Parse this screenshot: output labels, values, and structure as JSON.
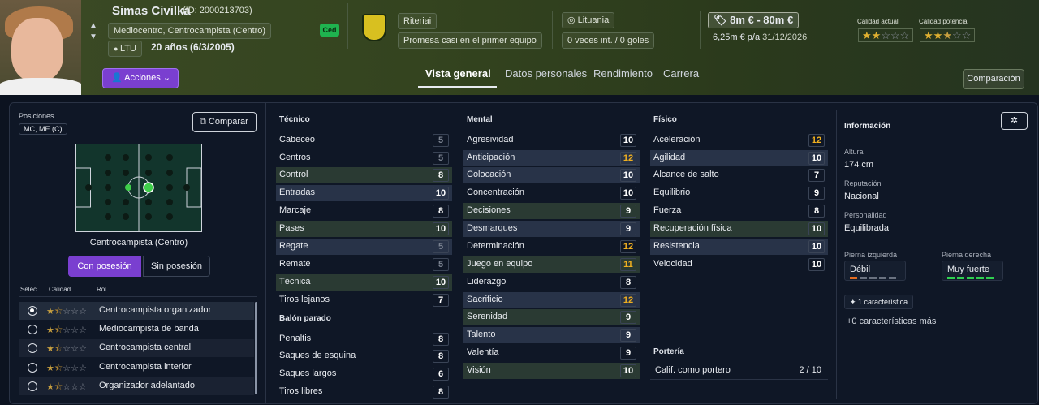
{
  "player": {
    "name": "Simas Civilka",
    "id_text": "(ID: 2000213703)",
    "position_text": "Mediocentro, Centrocampista (Centro)",
    "nation": "LTU",
    "age_text": "20 años (6/3/2005)",
    "badge": "Ced"
  },
  "club": {
    "name": "Riteriai",
    "status": "Promesa casi en el primer equipo"
  },
  "nationality": {
    "country": "Lituania",
    "caps": "0 veces int. / 0 goles"
  },
  "value": {
    "range": "8m € - 80m €",
    "wage": "6,25m € p/a",
    "contract_end": "31/12/2026"
  },
  "ratings": {
    "current_label": "Calidad actual",
    "potential_label": "Calidad potencial",
    "current_stars": 2,
    "potential_stars": 2.5
  },
  "actions_label": "Acciones",
  "tabs": [
    "Vista general",
    "Datos personales",
    "Rendimiento",
    "Carrera"
  ],
  "comparison_btn": "Comparación",
  "left": {
    "positions_label": "Posiciones",
    "positions_value": "MC, ME (C)",
    "compare_btn": "Comparar",
    "pitch_caption": "Centrocampista (Centro)",
    "with_ball": "Con posesión",
    "without_ball": "Sin posesión",
    "col_select": "Selec...",
    "col_quality": "Calidad",
    "col_role": "Rol",
    "roles": [
      {
        "name": "Centrocampista organizador",
        "stars": 1.5
      },
      {
        "name": "Mediocampista de banda",
        "stars": 1.5
      },
      {
        "name": "Centrocampista central",
        "stars": 1.5
      },
      {
        "name": "Centrocampista interior",
        "stars": 1.5
      },
      {
        "name": "Organizador adelantado",
        "stars": 1.5
      }
    ]
  },
  "attributes": {
    "tecnico_label": "Técnico",
    "tecnico": [
      [
        "Cabeceo",
        "5"
      ],
      [
        "Centros",
        "5"
      ],
      [
        "Control",
        "8"
      ],
      [
        "Entradas",
        "10"
      ],
      [
        "Marcaje",
        "8"
      ],
      [
        "Pases",
        "10"
      ],
      [
        "Regate",
        "5"
      ],
      [
        "Remate",
        "5"
      ],
      [
        "Técnica",
        "10"
      ],
      [
        "Tiros lejanos",
        "7"
      ]
    ],
    "balon_label": "Balón parado",
    "balon": [
      [
        "Penaltis",
        "8"
      ],
      [
        "Saques de esquina",
        "8"
      ],
      [
        "Saques largos",
        "6"
      ],
      [
        "Tiros libres",
        "8"
      ]
    ],
    "mental_label": "Mental",
    "mental": [
      [
        "Agresividad",
        "10"
      ],
      [
        "Anticipación",
        "12"
      ],
      [
        "Colocación",
        "10"
      ],
      [
        "Concentración",
        "10"
      ],
      [
        "Decisiones",
        "9"
      ],
      [
        "Desmarques",
        "9"
      ],
      [
        "Determinación",
        "12"
      ],
      [
        "Juego en equipo",
        "11"
      ],
      [
        "Liderazgo",
        "8"
      ],
      [
        "Sacrificio",
        "12"
      ],
      [
        "Serenidad",
        "9"
      ],
      [
        "Talento",
        "9"
      ],
      [
        "Valentía",
        "9"
      ],
      [
        "Visión",
        "10"
      ]
    ],
    "fisico_label": "Físico",
    "fisico": [
      [
        "Aceleración",
        "12"
      ],
      [
        "Agilidad",
        "10"
      ],
      [
        "Alcance de salto",
        "7"
      ],
      [
        "Equilibrio",
        "9"
      ],
      [
        "Fuerza",
        "8"
      ],
      [
        "Recuperación física",
        "10"
      ],
      [
        "Resistencia",
        "10"
      ],
      [
        "Velocidad",
        "10"
      ]
    ],
    "porteria_label": "Portería",
    "gk_label": "Calif. como portero",
    "gk_value": "2 / 10"
  },
  "info": {
    "title": "Información",
    "height_label": "Altura",
    "height": "174 cm",
    "rep_label": "Reputación",
    "rep": "Nacional",
    "pers_label": "Personalidad",
    "pers": "Equilibrada",
    "left_foot_label": "Pierna izquierda",
    "left_foot": "Débil",
    "right_foot_label": "Pierna derecha",
    "right_foot": "Muy fuerte",
    "traits_btn": "1 característica",
    "more_traits": "+0 características más"
  }
}
